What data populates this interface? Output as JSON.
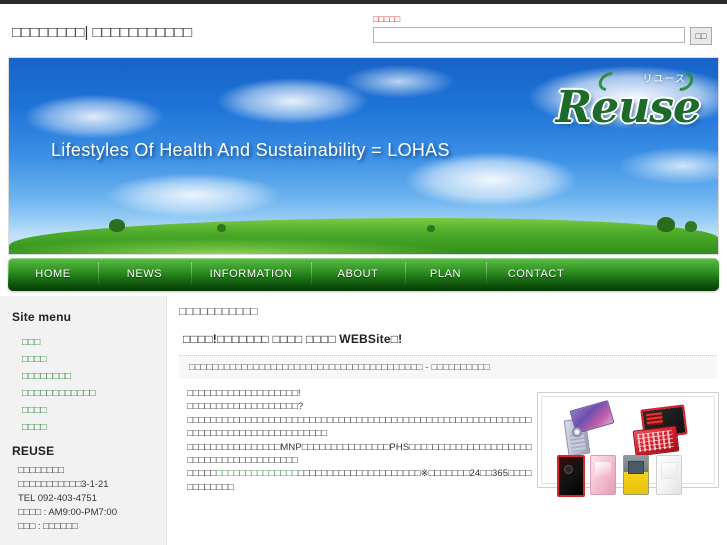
{
  "header": {
    "site_title": "□□□□□□□□| □□□□□□□□□□□",
    "search_label": "□□□□□",
    "search_value": "",
    "search_placeholder": "",
    "search_button": "□□"
  },
  "hero": {
    "tagline": "Lifestyles Of Health And Sustainability = LOHAS",
    "logo_word": "Reuse",
    "logo_kana": "リユース"
  },
  "nav": {
    "items": [
      {
        "label": "HOME"
      },
      {
        "label": "NEWS"
      },
      {
        "label": "INFORMATION"
      },
      {
        "label": "ABOUT"
      },
      {
        "label": "PLAN"
      },
      {
        "label": "CONTACT"
      }
    ]
  },
  "sidebar": {
    "menu_heading": "Site menu",
    "items": [
      {
        "label": "□□□"
      },
      {
        "label": "□□□□"
      },
      {
        "label": "□□□□□□□□"
      },
      {
        "label": "□□□□□□□□□□□□"
      },
      {
        "label": "□□□□"
      },
      {
        "label": "□□□□"
      }
    ],
    "company_heading": "REUSE",
    "address": [
      "□□□□□□□□",
      "□□□□□□□□□□□3-1-21",
      "TEL 092-403-4751",
      "□□□□ : AM9:00-PM7:00",
      "□□□ : □□□□□□"
    ]
  },
  "content": {
    "title": "□□□□□□□□□□□",
    "subtitle": "□□□□!□□□□□□□ □□□□ □□□□ WEBSite□!",
    "info_bar": "□□□□□□□□□□□□□□□□□□□□□□□□□□□□□□□□□□□□□□□□ - □□□□□□□□□□",
    "paragraph_lines": [
      "□□□□□□□□□□□□□□□□□□□!",
      "□□□□□□□□□□□□□□□□□□□?",
      "□□□□□□□□□□□□□□□□□□□□□□□□□□□□□□□□□□□□□□□□□□□□□□□□□□□□□□□□□□□□□□□□□□□□□□□□□□□□□□□□□□□"
    ],
    "paragraph_mnp_pre": "□□□□□□□□□□□□□□□□",
    "paragraph_mnp": "MNP",
    "paragraph_mnp_mid": "□□□□□□□□□□□□□□□",
    "paragraph_phs": "PHS",
    "paragraph_mnp_post": "□□□□□□□□□□□□□□□□□□□□□□□□□□□□□□□□□□□□□□□□",
    "paragraph_link_pre": "□□□□□",
    "paragraph_link": "□□□□□□□□□□□□□□",
    "paragraph_link_post": "□□□□□□□□□□□□□□□□□□□□□",
    "paragraph_note_mark": "※",
    "paragraph_note_pre": "□□□□□□□",
    "paragraph_note_24": "24",
    "paragraph_note_mid": "□□",
    "paragraph_note_365": "365",
    "paragraph_note_post": "□□□□□□□□□□□□"
  },
  "phones_panel": {
    "caption": "",
    "devices": [
      "slider-phone-purple",
      "flip-phone-red",
      "bar-phone-red-black",
      "bar-phone-pink",
      "bar-phone-gray-yellow",
      "bar-phone-white"
    ]
  },
  "colors": {
    "nav_green_top": "#5fbf4a",
    "nav_green_bottom": "#093d08",
    "link_green": "#2f7d35",
    "alert_red": "#e01b1b",
    "sidebar_bg": "#f2f2f2",
    "sky_blue": "#1f74d8",
    "grass_green": "#4fae2b"
  }
}
